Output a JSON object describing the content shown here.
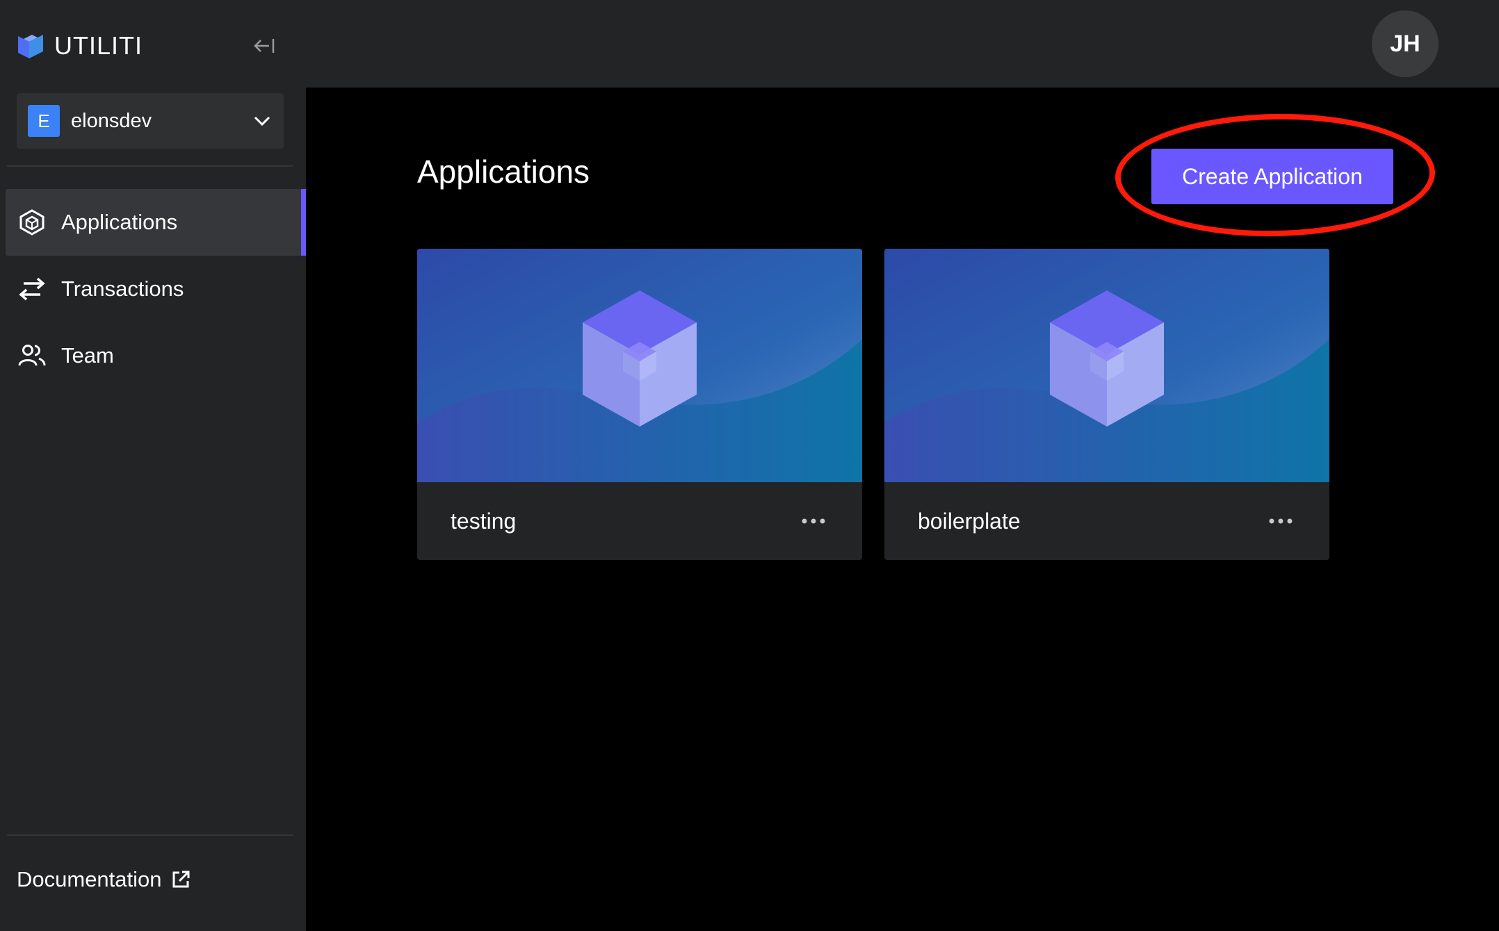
{
  "brand": {
    "name": "UTILITI",
    "logo_icon": "utiliti-logo-icon"
  },
  "sidebar": {
    "collapse_icon": "collapse-left-icon",
    "workspace": {
      "initial": "E",
      "name": "elonsdev",
      "badge_color": "#3b82f6"
    },
    "nav": [
      {
        "label": "Applications",
        "icon": "cube-icon",
        "active": true
      },
      {
        "label": "Transactions",
        "icon": "swap-arrows-icon",
        "active": false
      },
      {
        "label": "Team",
        "icon": "people-icon",
        "active": false
      }
    ],
    "footer": {
      "docs_label": "Documentation",
      "docs_icon": "external-link-icon"
    }
  },
  "header": {
    "avatar_initials": "JH"
  },
  "main": {
    "title": "Applications",
    "create_button": "Create Application",
    "cards": [
      {
        "name": "testing"
      },
      {
        "name": "boilerplate"
      }
    ]
  },
  "colors": {
    "accent": "#6b57ff",
    "annotation": "#ff1a0a",
    "sidebar_bg": "#232425",
    "page_bg": "#000000"
  }
}
